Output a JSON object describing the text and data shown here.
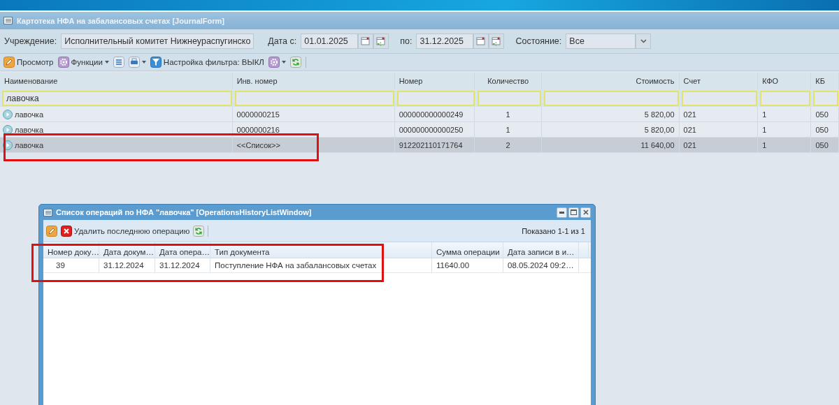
{
  "window": {
    "title": "Картотека НФА на забалансовых счетах [JournalForm]"
  },
  "filters": [
    {
      "kind": "text",
      "label": "Учреждение:",
      "value": "Исполнительный комитет Нижнеураспугинско"
    },
    {
      "kind": "date",
      "label": "Дата с:",
      "value": "01.01.2025"
    },
    {
      "kind": "date",
      "label": "по:",
      "value": "31.12.2025"
    },
    {
      "kind": "select",
      "label": "Состояние:",
      "value": "Все"
    }
  ],
  "toolbar": [
    {
      "kind": "pencil",
      "label": "Просмотр",
      "dropdown": false
    },
    {
      "kind": "gear",
      "label": "Функции",
      "dropdown": true
    },
    {
      "kind": "list",
      "dropdown": false
    },
    {
      "kind": "print",
      "dropdown": true
    },
    {
      "kind": "funnel",
      "label": "Настройка фильтра: ВЫКЛ",
      "dropdown": false
    },
    {
      "kind": "gear",
      "dropdown": true
    },
    {
      "kind": "refresh",
      "dropdown": false
    }
  ],
  "grid": {
    "columns": [
      {
        "label": "Наименование",
        "filter": "лавочка"
      },
      {
        "label": "Инв. номер"
      },
      {
        "label": "Номер"
      },
      {
        "label": "Количество"
      },
      {
        "label": "Стоимость"
      },
      {
        "label": "Счет"
      },
      {
        "label": "КФО"
      },
      {
        "label": "КБ"
      }
    ],
    "rows": [
      {
        "selected": false,
        "cells": [
          "лавочка",
          "0000000215",
          "000000000000249",
          "1",
          "5 820,00",
          "021",
          "1",
          "050"
        ]
      },
      {
        "selected": false,
        "cells": [
          "лавочка",
          "0000000216",
          "000000000000250",
          "1",
          "5 820,00",
          "021",
          "1",
          "050"
        ]
      },
      {
        "selected": true,
        "cells": [
          "лавочка",
          "<<Список>>",
          "912202110171764",
          "2",
          "11 640,00",
          "021",
          "1",
          "050"
        ]
      }
    ]
  },
  "dialog": {
    "title": "Список операций по НФА \"лавочка\" [OperationsHistoryListWindow]",
    "toolbar": [
      {
        "kind": "pencil"
      },
      {
        "kind": "delete",
        "label": "Удалить последнюю операцию"
      },
      {
        "kind": "refresh"
      }
    ],
    "paging": "Показано 1-1 из 1",
    "columns": [
      "Номер доку…",
      "Дата докум…",
      "Дата опера…",
      "Тип документа",
      "Сумма операции",
      "Дата записи в и…"
    ],
    "rows": [
      {
        "cells": [
          "39",
          "31.12.2024",
          "31.12.2024",
          "Поступление НФА на забалансовых счетах",
          "11640.00",
          "08.05.2024 09:2…"
        ]
      }
    ]
  }
}
